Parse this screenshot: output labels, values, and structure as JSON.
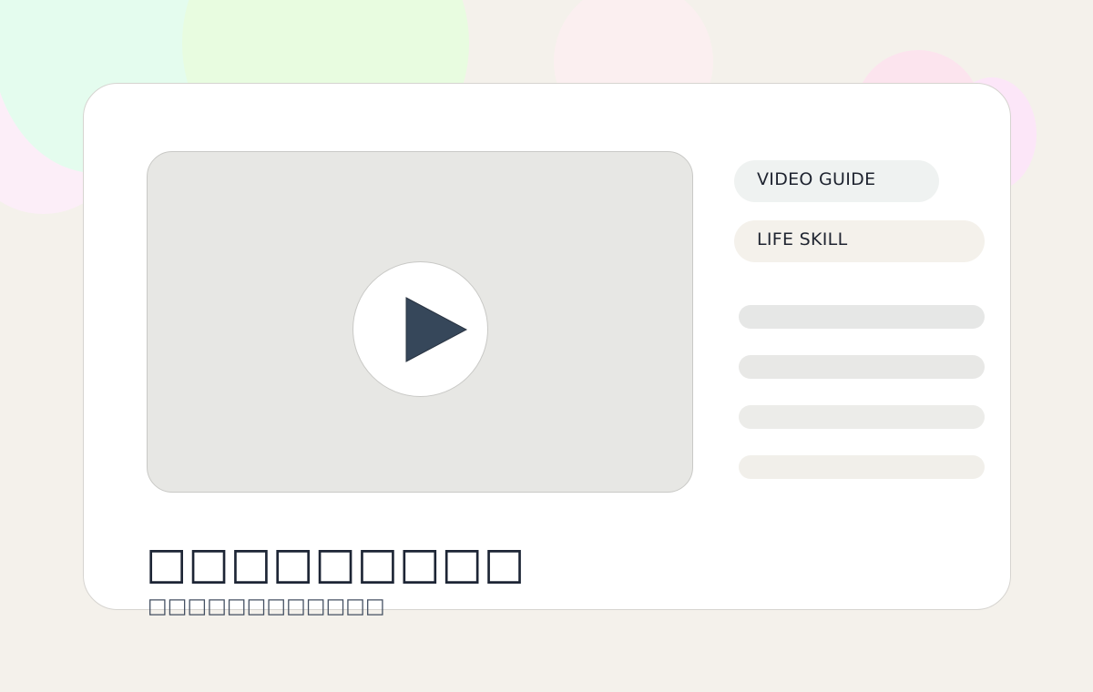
{
  "colors": {
    "background": "#F4F1EB",
    "card": "#FFFFFF",
    "video_placeholder": "#E7E7E4",
    "play_triangle": "#36475A",
    "title_text": "#1D2535",
    "subtitle_text": "#445062"
  },
  "player": {
    "play_icon": "play-icon"
  },
  "tags": [
    {
      "label": "VIDEO GUIDE"
    },
    {
      "label": "LIFE SKILL"
    }
  ],
  "content": {
    "title": "□□□□□□□□□",
    "subtitle": "□□□□□□□□□□□□"
  }
}
